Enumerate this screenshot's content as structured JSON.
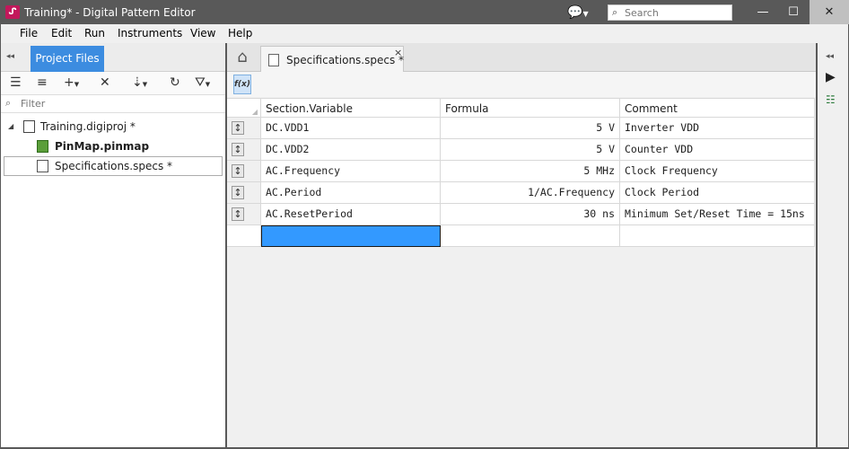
{
  "window": {
    "app_icon": "ᔑ",
    "title": "Training* - Digital Pattern Editor",
    "search_placeholder": "Search",
    "buttons": {
      "minimize": "—",
      "maximize": "☐",
      "close": "✕"
    }
  },
  "menu": [
    "File",
    "Edit",
    "Run",
    "Instruments",
    "View",
    "Help"
  ],
  "left_panel": {
    "tab_label": "Project Files",
    "filter_placeholder": "Filter",
    "tree": [
      {
        "label": "Training.digiproj *",
        "icon": "project-icon",
        "level": 0,
        "bold": false
      },
      {
        "label": "PinMap.pinmap",
        "icon": "pinmap-icon",
        "level": 1,
        "bold": true
      },
      {
        "label": "Specifications.specs *",
        "icon": "specs-icon",
        "level": 1,
        "bold": false,
        "selected": true
      }
    ]
  },
  "editor": {
    "tab_label": "Specifications.specs *",
    "tab_close": "×",
    "fx_label": "f(x)",
    "columns": [
      "Section.Variable",
      "Formula",
      "Comment"
    ],
    "rows": [
      {
        "variable": "DC.VDD1",
        "formula": "5 V",
        "comment": "Inverter VDD"
      },
      {
        "variable": "DC.VDD2",
        "formula": "5 V",
        "comment": "Counter VDD"
      },
      {
        "variable": "AC.Frequency",
        "formula": "5 MHz",
        "comment": "Clock Frequency"
      },
      {
        "variable": "AC.Period",
        "formula": "1/AC.Frequency",
        "comment": "Clock Period"
      },
      {
        "variable": "AC.ResetPeriod",
        "formula": "30 ns",
        "comment": "Minimum Set/Reset Time = 15ns"
      }
    ]
  },
  "colors": {
    "accent": "#3c8ce0",
    "selected_cell": "#3399ff",
    "chrome": "#595959"
  }
}
